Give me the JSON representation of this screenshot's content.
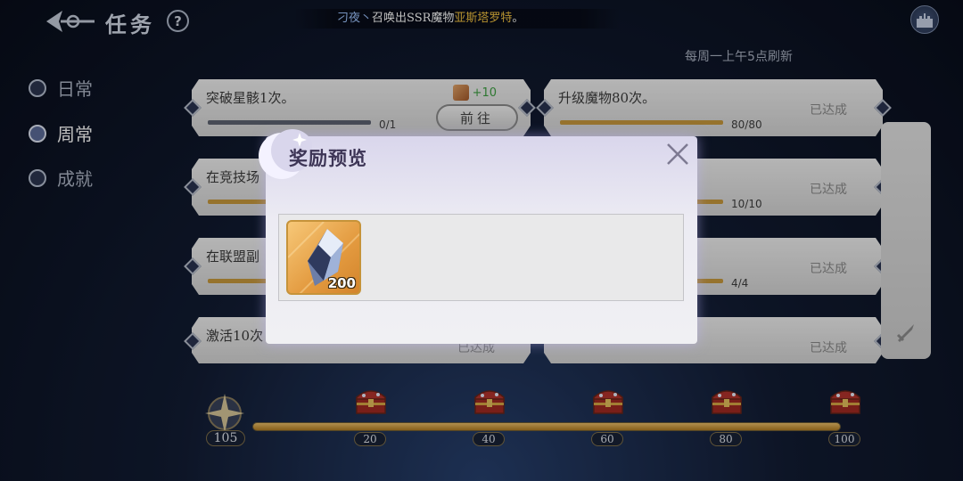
{
  "header": {
    "title": "任务",
    "help": "?",
    "ticker": {
      "name": "刁夜丶",
      "text": "召唤出SSR魔物",
      "highlight": "亚斯塔罗特",
      "end": "。"
    },
    "refresh_note": "每周一上午5点刷新"
  },
  "tabs": [
    {
      "label": "日常",
      "active": false
    },
    {
      "label": "周常",
      "active": true
    },
    {
      "label": "成就",
      "active": false
    }
  ],
  "quests": [
    {
      "title": "突破星骸1次。",
      "progress": "0/1",
      "ratio": 0.0,
      "status": "",
      "button": "前往",
      "reward": "+10"
    },
    {
      "title": "升级魔物80次。",
      "progress": "80/80",
      "ratio": 1.0,
      "status": "已达成"
    },
    {
      "title": "在竞技场",
      "progress": "",
      "ratio": 1.0,
      "status": ""
    },
    {
      "title": "",
      "progress": "10/10",
      "ratio": 1.0,
      "status": "已达成"
    },
    {
      "title": "在联盟副",
      "progress": "",
      "ratio": 1.0,
      "status": ""
    },
    {
      "title": "",
      "progress": "4/4",
      "ratio": 1.0,
      "status": "已达成"
    },
    {
      "title": "激活10次",
      "progress": "",
      "ratio": 1.0,
      "status": "已达成"
    },
    {
      "title": "",
      "progress": "",
      "ratio": 1.0,
      "status": "已达成"
    }
  ],
  "activity": {
    "points": "105",
    "fill_ratio": 1.0,
    "milestones": [
      "20",
      "40",
      "60",
      "80",
      "100"
    ]
  },
  "modal": {
    "title": "奖励预览",
    "reward_count": "200",
    "reward_icon": "crystal-icon"
  },
  "colors": {
    "gold": "#c99a3c",
    "done_green": "#3ea042",
    "highlight": "#f0c040"
  }
}
